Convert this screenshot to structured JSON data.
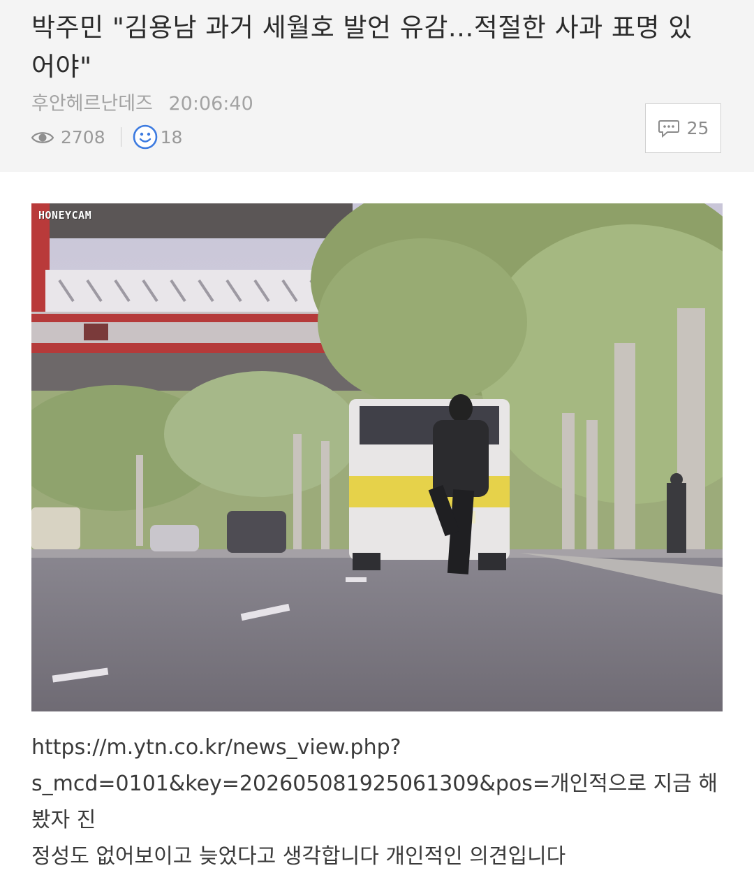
{
  "post": {
    "title": "박주민 \"김용남 과거 세월호 발언 유감...적절한 사과 표명 있어야\"",
    "author": "후안헤르난데즈",
    "time": "20:06:40",
    "views": "2708",
    "likes": "18",
    "comments": "25"
  },
  "media": {
    "watermark": "HONEYCAM"
  },
  "content": {
    "line1": "https://m.ytn.co.kr/news_view.php?",
    "line2": "s_mcd=0101&key=202605081925061309&pos=개인적으로 지금 해봤자 진",
    "line3": "정성도 없어보이고 늦었다고 생각합니다 개인적인 의견입니다"
  },
  "icons": {
    "views": "eye-icon",
    "likes": "smile-icon",
    "comments": "speech-bubble-icon"
  },
  "colors": {
    "header_bg": "#f4f4f4",
    "like_icon": "#3d7be0"
  }
}
